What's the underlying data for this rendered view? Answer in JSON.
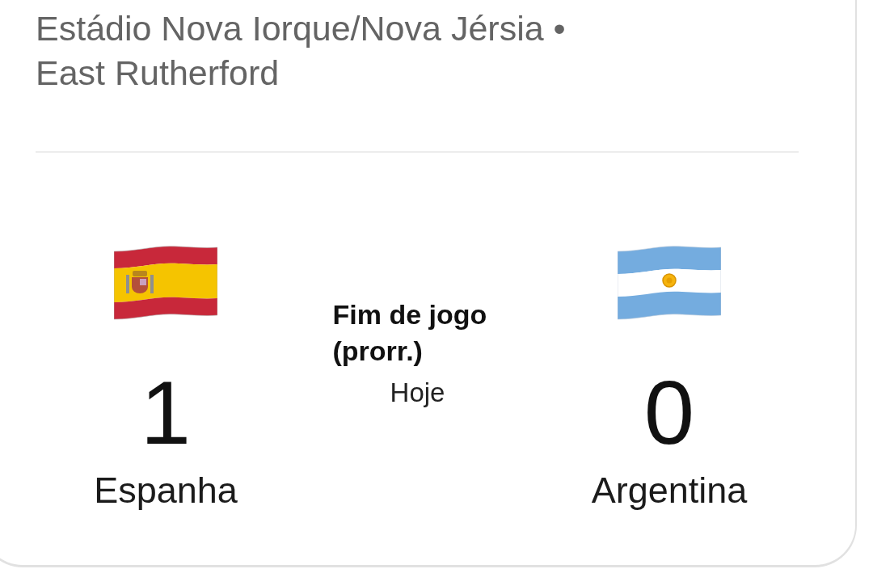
{
  "match_card": {
    "location_lines": [
      "Estádio Nova Iorque/Nova Jérsia •",
      "East Rutherford"
    ],
    "teams": [
      {
        "kind": "spain",
        "score": "1",
        "name": "Espanha"
      },
      {
        "kind": "argentina",
        "score": "0",
        "name": "Argentina"
      }
    ],
    "status": "Fim de jogo (prorr.)",
    "date": "Hoje"
  }
}
